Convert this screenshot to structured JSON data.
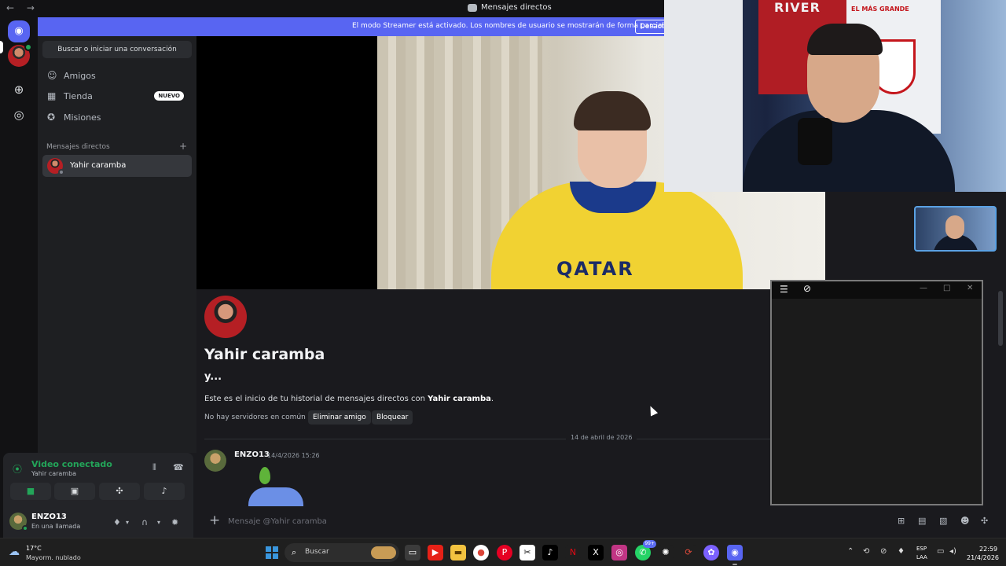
{
  "window": {
    "title": "Mensajes directos",
    "nav_arrows": "← →"
  },
  "banner": {
    "text": "El modo Streamer está activado. Los nombres de usuario se mostrarán de forma parcial.",
    "button_label": "Desactivar"
  },
  "sidebar": {
    "search_label": "Buscar o iniciar una conversación",
    "nav": [
      {
        "label": "Amigos",
        "icon": "friends-icon"
      },
      {
        "label": "Tienda",
        "icon": "shop-icon",
        "badge": "NUEVO"
      },
      {
        "label": "Misiones",
        "icon": "quests-icon"
      }
    ],
    "section_title": "Mensajes directos",
    "dms": [
      {
        "name": "Yahir caramba"
      }
    ]
  },
  "voice": {
    "status": "Video conectado",
    "channel": "Yahir caramba"
  },
  "user": {
    "name": "ENZO13",
    "status": "En una llamada"
  },
  "stream": {
    "pip_text": {
      "river": "RIVER",
      "grande": "EL MÁS GRANDE"
    },
    "jersey_text": "QATAR"
  },
  "chat": {
    "name": "Yahir caramba",
    "subtitle": "y...",
    "intro_prefix": "Este es el inicio de tu historial de mensajes directos con",
    "intro_name": "Yahir caramba",
    "intro_suffix": ".",
    "no_common": "No hay servidores en común",
    "remove_friend": "Eliminar amigo",
    "block": "Bloquear",
    "date_divider": "14 de abril de 2026",
    "message": {
      "author": "ENZO13",
      "time": "14/4/2026 15:26"
    }
  },
  "composer": {
    "placeholder": "Mensaje @Yahir caramba"
  },
  "taskbar": {
    "weather_temp": "17°C",
    "weather_cond": "Mayorm. nublado",
    "search_label": "Buscar",
    "whatsapp_badge": "99+",
    "lang1": "ESP",
    "lang2": "LAA",
    "time": "22:59",
    "date": "21/4/2026"
  },
  "colors": {
    "accent": "#5865f2",
    "online": "#23a559",
    "background": "#1a1a1e"
  }
}
